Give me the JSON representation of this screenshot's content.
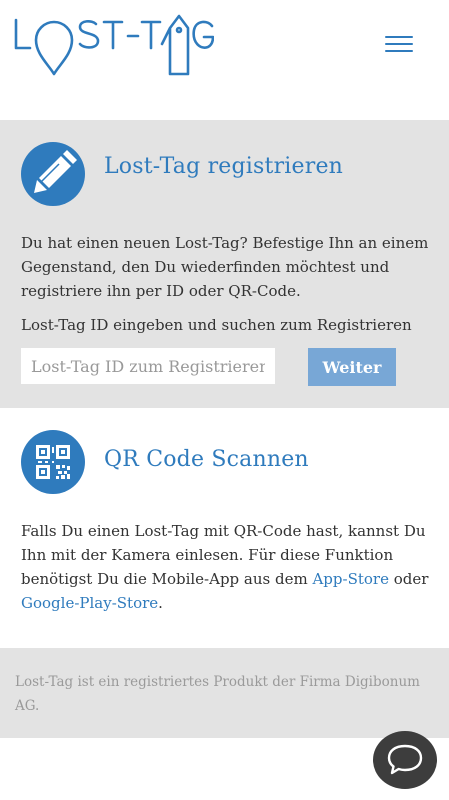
{
  "header": {
    "logo_alt": "Lost-Tag",
    "menu_icon": "hamburger-menu-icon",
    "accent": "#2f7bbd"
  },
  "register": {
    "icon": "pencil-icon",
    "title": "Lost-Tag registrieren",
    "description": "Du hat einen neuen Lost-Tag? Befestige Ihn an einem Gegenstand, den Du wiederfinden möchtest und registriere ihn per ID oder QR-Code.",
    "input_label": "Lost-Tag ID eingeben und suchen zum Registrieren",
    "input_placeholder": "Lost-Tag ID zum Registrieren",
    "input_value": "",
    "button_label": "Weiter"
  },
  "qr": {
    "icon": "qr-code-icon",
    "title": "QR Code Scannen",
    "text_before": "Falls Du einen Lost-Tag mit QR-Code hast, kannst Du Ihn mit der Kamera einlesen. Für diese Funktion benötigst Du die Mobile-App aus dem ",
    "link_appstore": "App-Store",
    "text_middle": " oder ",
    "link_playstore": "Google-Play-Store",
    "text_after": "."
  },
  "footer": {
    "text": "Lost-Tag ist ein registriertes Produkt der Firma Digibonum AG."
  },
  "chat": {
    "icon": "chat-bubble-icon"
  },
  "colors": {
    "accent": "#2f7bbd",
    "section_bg": "#e3e3e3",
    "button_bg": "#78a7d6",
    "chat_bg": "#3d3d3d"
  }
}
